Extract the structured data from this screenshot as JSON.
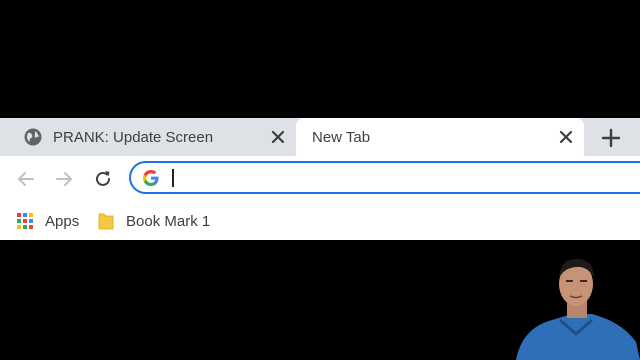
{
  "tabs": [
    {
      "title": "PRANK: Update Screen",
      "favicon": "globe-icon",
      "active": false
    },
    {
      "title": "New Tab",
      "favicon": "",
      "active": true
    }
  ],
  "toolbar": {
    "back_icon": "back-arrow-icon",
    "forward_icon": "forward-arrow-icon",
    "reload_icon": "reload-icon",
    "omnibox": {
      "value": "",
      "placeholder": "",
      "search_icon": "google-g-icon"
    }
  },
  "bookmarks": {
    "items": [
      {
        "label": "Apps",
        "icon": "apps-grid-icon"
      },
      {
        "label": "Book Mark 1",
        "icon": "folder-icon"
      }
    ]
  },
  "colors": {
    "tabstrip": "#dee1e6",
    "active_tab": "#ffffff",
    "omnibox_border": "#1a73e8",
    "background": "#000000"
  }
}
